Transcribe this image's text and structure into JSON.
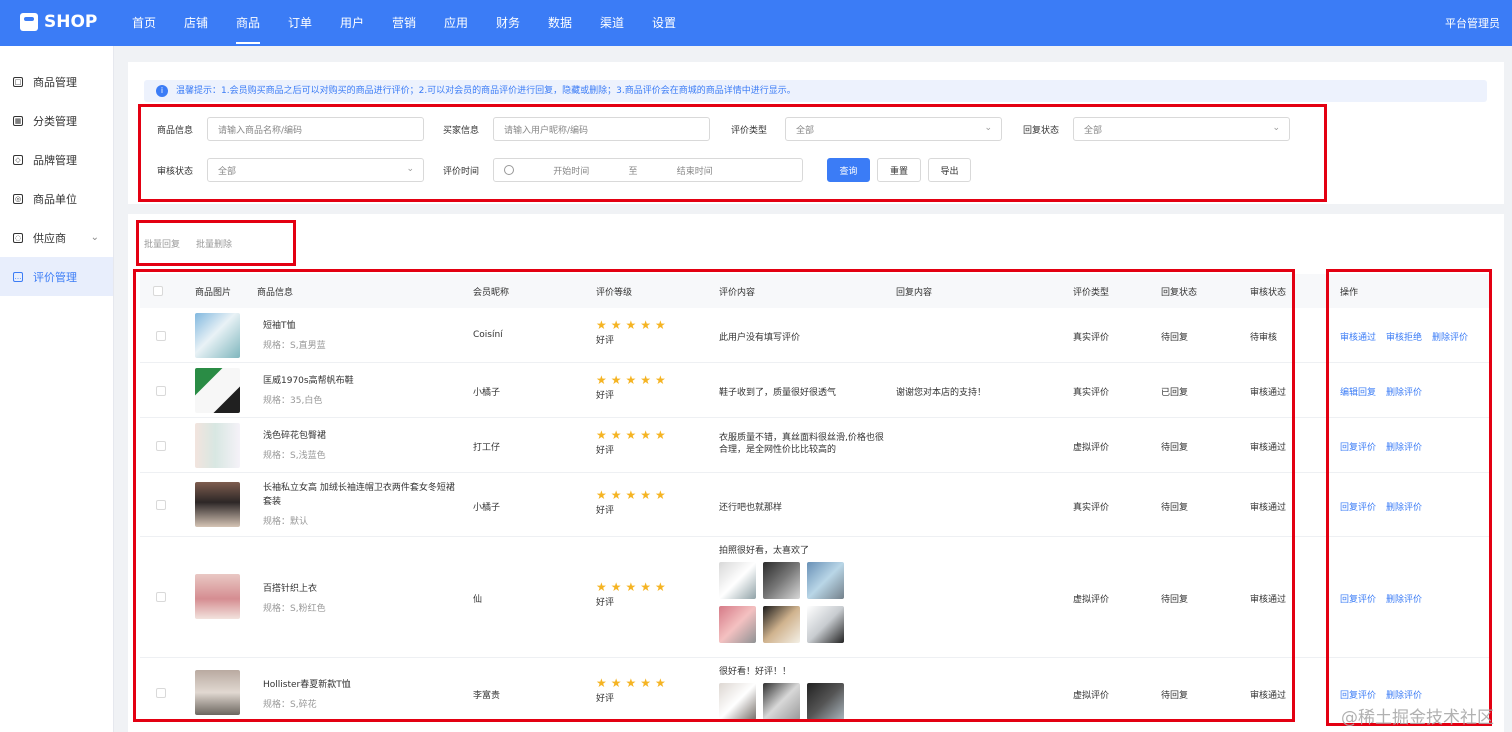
{
  "app": {
    "logo_text": "SHOP",
    "admin_label": "平台管理员",
    "active_tab": "商品"
  },
  "nav": [
    "首页",
    "店铺",
    "商品",
    "订单",
    "用户",
    "营销",
    "应用",
    "财务",
    "数据",
    "渠道",
    "设置"
  ],
  "sidebar": [
    {
      "label": "商品管理",
      "icon": "clipboard-icon"
    },
    {
      "label": "分类管理",
      "icon": "category-icon"
    },
    {
      "label": "品牌管理",
      "icon": "brand-icon"
    },
    {
      "label": "商品单位",
      "icon": "unit-icon"
    },
    {
      "label": "供应商",
      "icon": "supplier-icon",
      "chevron": "⌄"
    },
    {
      "label": "评价管理",
      "icon": "comment-icon",
      "active": true
    }
  ],
  "tip": {
    "icon": "i",
    "text": "温馨提示：1.会员购买商品之后可以对购买的商品进行评价；2.可以对会员的商品评价进行回复，隐藏或删除；3.商品评价会在商城的商品详情中进行显示。"
  },
  "filters": {
    "product_label": "商品信息",
    "product_placeholder": "请输入商品名称/编码",
    "buyer_label": "买家信息",
    "buyer_placeholder": "请输入用户昵称/编码",
    "rating_type_label": "评价类型",
    "rating_type_value": "全部",
    "reply_status_label": "回复状态",
    "reply_status_value": "全部",
    "audit_status_label": "审核状态",
    "audit_status_value": "全部",
    "time_label": "评价时间",
    "start_time": "开始时间",
    "to": "至",
    "end_time": "结束时间",
    "query": "查询",
    "reset": "重置",
    "export": "导出"
  },
  "batch": {
    "reply": "批量回复",
    "delete": "批量删除"
  },
  "columns": [
    "商品图片",
    "商品信息",
    "会员昵称",
    "评价等级",
    "评价内容",
    "回复内容",
    "评价类型",
    "回复状态",
    "审核状态",
    "操作"
  ],
  "rows": [
    {
      "title": "短袖T恤",
      "spec": "规格：S,直男蓝",
      "member": "Coisíní",
      "stars": "★★★★★",
      "grade": "好评",
      "content": "此用户没有填写评价",
      "reply": "",
      "type": "真实评价",
      "reply_status": "待回复",
      "audit": "待审核",
      "actions": [
        "审核通过",
        "审核拒绝",
        "删除评价"
      ]
    },
    {
      "title": "匡威1970s高帮帆布鞋",
      "spec": "规格：35,白色",
      "member": "小橘子",
      "stars": "★★★★★",
      "grade": "好评",
      "content": "鞋子收到了，质量很好很透气",
      "reply": "谢谢您对本店的支持！",
      "type": "真实评价",
      "reply_status": "已回复",
      "audit": "审核通过",
      "actions": [
        "编辑回复",
        "删除评价"
      ]
    },
    {
      "title": "浅色碎花包臀裙",
      "spec": "规格：S,浅蓝色",
      "member": "打工仔",
      "stars": "★★★★★",
      "grade": "好评",
      "content": "衣服质量不错，真丝面料很丝滑,价格也很合理，是全网性价比比较高的",
      "reply": "",
      "type": "虚拟评价",
      "reply_status": "待回复",
      "audit": "审核通过",
      "actions": [
        "回复评价",
        "删除评价"
      ]
    },
    {
      "title": "长袖私立女高 加绒长袖连帽卫衣两件套女冬短裙套装",
      "spec": "规格：默认",
      "member": "小橘子",
      "stars": "★★★★★",
      "grade": "好评",
      "content": "还行吧也就那样",
      "reply": "",
      "type": "真实评价",
      "reply_status": "待回复",
      "audit": "审核通过",
      "actions": [
        "回复评价",
        "删除评价"
      ]
    },
    {
      "title": "百搭针织上衣",
      "spec": "规格：S,粉红色",
      "member": "仙",
      "stars": "★★★★★",
      "grade": "好评",
      "content": "拍照很好看，太喜欢了",
      "reply": "",
      "type": "虚拟评价",
      "reply_status": "待回复",
      "audit": "审核通过",
      "actions": [
        "回复评价",
        "删除评价"
      ]
    },
    {
      "title": "Hollister春夏新款T恤",
      "spec": "规格：S,碎花",
      "member": "李富贵",
      "stars": "★★★★★",
      "grade": "好评",
      "content": "很好看！好评！！",
      "reply": "",
      "type": "虚拟评价",
      "reply_status": "待回复",
      "audit": "审核通过",
      "actions": [
        "回复评价",
        "删除评价"
      ]
    }
  ],
  "watermark": "@稀土掘金技术社区",
  "colors": {
    "primary": "#3b7cf6",
    "highlight": "#e30012",
    "star": "#f5b423"
  }
}
